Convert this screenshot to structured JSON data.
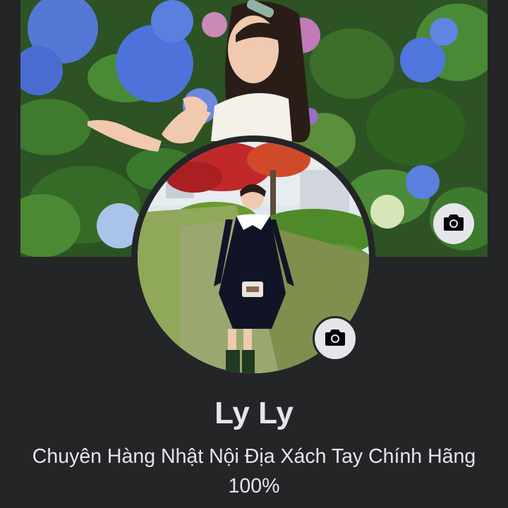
{
  "profile": {
    "name": "Ly Ly",
    "bio": "Chuyên Hàng Nhật Nội Địa Xách Tay Chính Hãng 100%"
  },
  "icons": {
    "cover_camera": "camera-icon",
    "avatar_camera": "camera-icon"
  },
  "colors": {
    "background": "#242526",
    "text": "#e4e6eb",
    "camera_button": "#e4e6eb",
    "camera_glyph": "#050505"
  }
}
